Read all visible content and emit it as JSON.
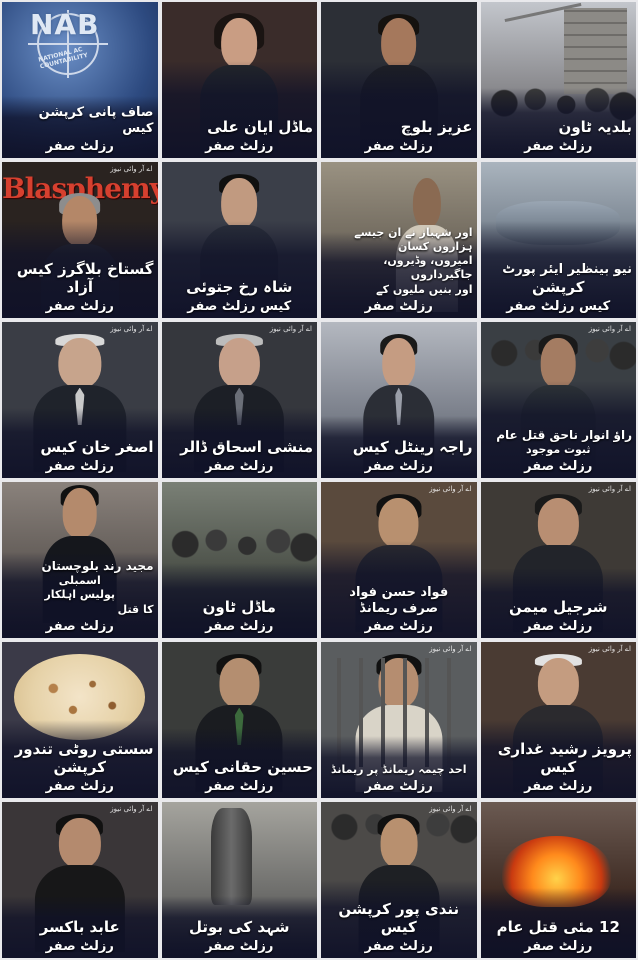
{
  "channel_label": "اے آر وائی نیوز",
  "result_label": "رزلٹ صفر",
  "tiles": [
    {
      "id": "nab",
      "logo_text": "NAB",
      "logo_subtext": "NATIONAL AC COUNTABILITY",
      "title": "صاف پانی کرپشن کیس",
      "result": "رزلٹ صفر",
      "bg": "#2d4a80"
    },
    {
      "id": "ayyan",
      "title": "ماڈل ایان علی",
      "result": "رزلٹ صفر",
      "bg": "#3a2c2a"
    },
    {
      "id": "uzair",
      "title": "عزیز بلوچ",
      "result": "رزلٹ صفر",
      "bg": "#2c2f36"
    },
    {
      "id": "baldia",
      "title": "بلدیہ ٹاون",
      "result": "رزلٹ صفر",
      "bg": "#6d6d72"
    },
    {
      "id": "blasphemy",
      "banner": "Blasphemy",
      "title": "گستاخ بلاگرز کیس",
      "subtitle": "آزاد",
      "result": "رزلٹ صفر",
      "bg": "#2a2320"
    },
    {
      "id": "shahrukh",
      "title": "شاہ رخ جتوئی",
      "subtitle": "کیس رزلٹ صفر",
      "result": "",
      "bg": "#3b3f49"
    },
    {
      "id": "land",
      "lines": [
        "اور شہباز نے ان جیسے ہزاروں کسان",
        "امیروں، وڈیروں، جاگیرداروں",
        "اور بنیں ملیوں کے"
      ],
      "title": "",
      "result": "رزلٹ صفر",
      "bg": "#6a6358"
    },
    {
      "id": "airport",
      "title": "نیو بینظیر ایئر پورٹ",
      "subtitle": "کرپشن",
      "result": "کیس رزلٹ صفر",
      "bg": "#6f7a86"
    },
    {
      "id": "asghar",
      "title": "اصغر خان کیس",
      "result": "رزلٹ صفر",
      "bg": "#3a3d45"
    },
    {
      "id": "ishaq",
      "title": "منشی اسحاق ڈالر",
      "result": "رزلٹ صفر",
      "bg": "#35373d"
    },
    {
      "id": "rental",
      "title": "راجہ رینٹل کیس",
      "result": "رزلٹ صفر",
      "bg": "#7a7f8a"
    },
    {
      "id": "rao",
      "title": "راؤ انوار ناحق قتل عام",
      "subtitle": "ثبوت موجود",
      "result": "رزلٹ صفر",
      "bg": "#3a3f44"
    },
    {
      "id": "majeed",
      "title": "مجید رند بلوچستان",
      "subtitle": "اسمبلی",
      "lines": [
        "پولیس اہلکار",
        "کا قتل"
      ],
      "result": "رزلٹ صفر",
      "bg": "#5c5652"
    },
    {
      "id": "modeltown",
      "title": "ماڈل ٹاون",
      "result": "رزلٹ صفر",
      "bg": "#4a4f47"
    },
    {
      "id": "fawad",
      "title": "فواد حسن فواد",
      "subtitle": "صرف ریمانڈ",
      "result": "رزلٹ صفر",
      "bg": "#5a4a3d"
    },
    {
      "id": "sharjeel",
      "title": "شرجیل میمن",
      "result": "رزلٹ صفر",
      "bg": "#3e3a36"
    },
    {
      "id": "roti",
      "title": "سستی روٹی تندور",
      "subtitle": "کرپشن",
      "result": "رزلٹ صفر",
      "bg": "#3b3a48"
    },
    {
      "id": "haqqani",
      "title": "حسین حقانی کیس",
      "result": "رزلٹ صفر",
      "bg": "#3a3c3a"
    },
    {
      "id": "ahad",
      "title": "احد چیمہ ریمانڈ پر ریمانڈ",
      "result": "رزلٹ صفر",
      "bg": "#5a5d5f"
    },
    {
      "id": "pervez",
      "title": "پرویز رشید غداری",
      "subtitle": "کیس",
      "result": "رزلٹ صفر",
      "bg": "#4a3b33"
    },
    {
      "id": "abid",
      "title": "عابد باکسر",
      "result": "رزلٹ صفر",
      "bg": "#3a3638"
    },
    {
      "id": "honey",
      "title": "شہد کی بوتل",
      "result": "رزلٹ صفر",
      "bg": "#6c6c6a"
    },
    {
      "id": "nandipur",
      "title": "نندی پور کرپشن",
      "subtitle": "کیس",
      "result": "رزلٹ صفر",
      "bg": "#4c4a48"
    },
    {
      "id": "may12",
      "title": "12 مئی قتل عام",
      "result": "رزلٹ صفر",
      "bg": "#3d2a22"
    }
  ]
}
